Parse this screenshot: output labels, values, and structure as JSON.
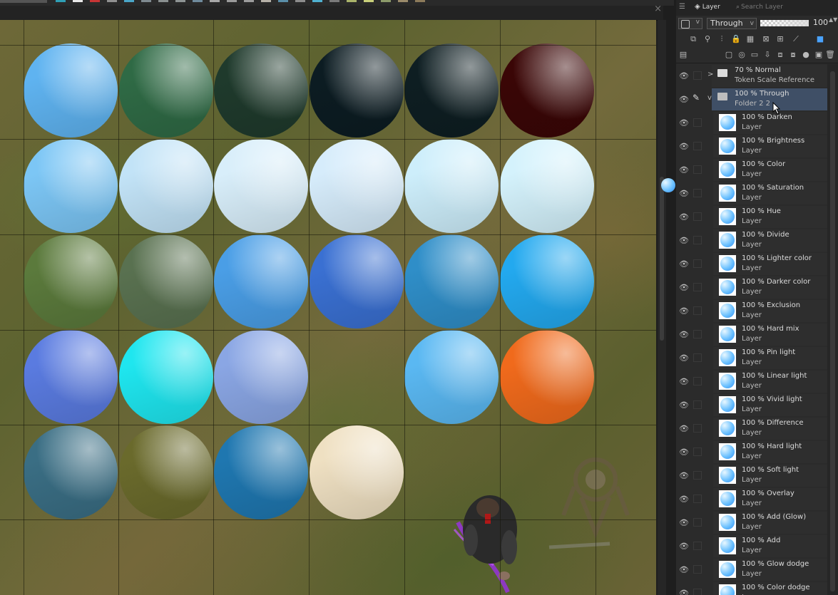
{
  "palette": {
    "swatches": [
      "#2f9fb5",
      "#e8e8e8",
      "#c73535",
      "#909090",
      "#4aa6c8",
      "#7f8a90",
      "#8a9090",
      "#8e9494",
      "#6f8a9c",
      "#a8a8a8",
      "#9a9a9a",
      "#9c9c9c",
      "#b6b1a8",
      "#5a8ea8",
      "#8c8c8c",
      "#4fb0d0",
      "#7a7a7a",
      "#aab36a",
      "#c8cf7a",
      "#8c9a6a",
      "#9a8a6a",
      "#8c7a5a"
    ]
  },
  "canvas": {
    "close_glyph": "×",
    "circle_colors": [
      [
        "#5fb3f0",
        "#2f6a45",
        "#1f3a2c",
        "#0c1c22",
        "#0e1e22",
        "#3a0606"
      ],
      [
        "#7cc6f5",
        "#c2e3f7",
        "#d8eefa",
        "#d6ecfb",
        "#cdeefb",
        "#d4f2fc"
      ],
      [
        "#5b7a3c",
        "#597150",
        "#4a9ee6",
        "#3a70d2",
        "#2f8ec8",
        "#23a9ef"
      ],
      [
        "#5a7be0",
        "#1fe6ef",
        "#8aa6e4",
        "",
        "#5ab8f2",
        "#f06a1c"
      ],
      [
        "#3a6e84",
        "#6a6a2c",
        "#1f77b0",
        "#efe0c2",
        "",
        ""
      ]
    ]
  },
  "layer_panel": {
    "menu_glyph": "☰",
    "tab_layer": "Layer",
    "tab_search": "Search Layer",
    "layer_type_arrow": "v",
    "blend_mode": "Through",
    "blend_arrow": "v",
    "opacity_value": "100",
    "opacity_fraction": 1.0,
    "spin_glyph": "▲▼",
    "expand_glyph": ">",
    "collapse_glyph": "v",
    "eye_glyph": "👁",
    "pen_glyph": "✎",
    "layers": [
      {
        "line1": "70 % Normal",
        "line2": "Token Scale Reference",
        "type": "folder",
        "expanded": false
      },
      {
        "line1": "100 % Through",
        "line2": "Folder 2 2",
        "type": "folder",
        "expanded": true,
        "selected": true
      },
      {
        "line1": "100 % Darken",
        "line2": "Layer"
      },
      {
        "line1": "100 % Brightness",
        "line2": "Layer"
      },
      {
        "line1": "100 % Color",
        "line2": "Layer"
      },
      {
        "line1": "100 % Saturation",
        "line2": "Layer"
      },
      {
        "line1": "100 % Hue",
        "line2": "Layer"
      },
      {
        "line1": "100 % Divide",
        "line2": "Layer"
      },
      {
        "line1": "100 % Lighter color",
        "line2": "Layer"
      },
      {
        "line1": "100 % Darker color",
        "line2": "Layer"
      },
      {
        "line1": "100 % Exclusion",
        "line2": "Layer"
      },
      {
        "line1": "100 % Hard mix",
        "line2": "Layer"
      },
      {
        "line1": "100 % Pin light",
        "line2": "Layer"
      },
      {
        "line1": "100 % Linear light",
        "line2": "Layer"
      },
      {
        "line1": "100 % Vivid light",
        "line2": "Layer"
      },
      {
        "line1": "100 % Difference",
        "line2": "Layer"
      },
      {
        "line1": "100 % Hard light",
        "line2": "Layer"
      },
      {
        "line1": "100 % Soft light",
        "line2": "Layer"
      },
      {
        "line1": "100 % Overlay",
        "line2": "Layer"
      },
      {
        "line1": "100 % Add (Glow)",
        "line2": "Layer"
      },
      {
        "line1": "100 % Add",
        "line2": "Layer"
      },
      {
        "line1": "100 % Glow dodge",
        "line2": "Layer"
      },
      {
        "line1": "100 % Color dodge",
        "line2": "Layer"
      }
    ]
  }
}
